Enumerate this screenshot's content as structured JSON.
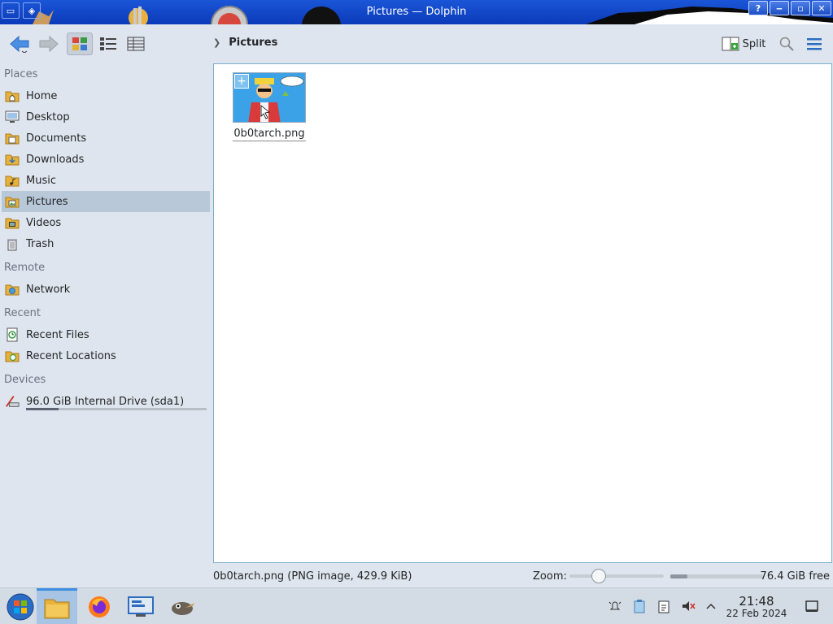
{
  "window": {
    "title": "Pictures — Dolphin",
    "buttons": {
      "help": "?",
      "minimize": "‒",
      "maximize": "▫",
      "close": "✕"
    }
  },
  "toolbar": {
    "breadcrumb": "Pictures",
    "split_label": "Split"
  },
  "sidebar": {
    "sections": [
      {
        "title": "Places",
        "items": [
          "Home",
          "Desktop",
          "Documents",
          "Downloads",
          "Music",
          "Pictures",
          "Videos",
          "Trash"
        ]
      },
      {
        "title": "Remote",
        "items": [
          "Network"
        ]
      },
      {
        "title": "Recent",
        "items": [
          "Recent Files",
          "Recent Locations"
        ]
      },
      {
        "title": "Devices",
        "items": [
          "96.0 GiB Internal Drive (sda1)"
        ]
      }
    ],
    "selected": "Pictures",
    "device_usage_fraction": 0.18
  },
  "files": [
    {
      "name": "0b0tarch.png"
    }
  ],
  "statusbar": {
    "selection_info": "0b0tarch.png (PNG image, 429.9 KiB)",
    "zoom_label": "Zoom:",
    "zoom_fraction": 0.28,
    "free_space": "76.4 GiB free",
    "used_fraction": 0.18
  },
  "taskbar": {
    "tasks": [
      "start-menu",
      "file-manager",
      "firefox",
      "system-settings",
      "gimp"
    ],
    "active_task": "file-manager",
    "time": "21:48",
    "date": "22 Feb 2024"
  },
  "colors": {
    "titlebar": "#0b3ab8",
    "selection": "#b8c8d8",
    "accent": "#3d8ee0"
  }
}
